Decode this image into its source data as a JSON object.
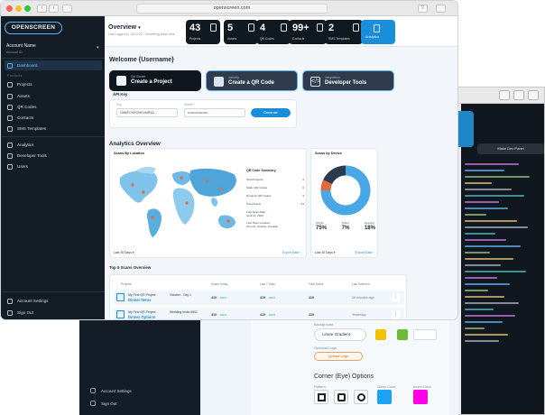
{
  "browser": {
    "url": "openscreen.com"
  },
  "brand": {
    "logo_text": "OPENSCREEN",
    "accent": "#1a8ed8",
    "sidebar_bg": "#141c25"
  },
  "account": {
    "name": "Account Name",
    "sub": "Account ID"
  },
  "sidebar": {
    "section_label": "Products",
    "items": [
      {
        "label": "Dashboard",
        "icon": "grid-icon"
      },
      {
        "label": "Projects",
        "icon": "folder-icon"
      },
      {
        "label": "Assets",
        "icon": "image-icon"
      },
      {
        "label": "QR Codes",
        "icon": "qr-icon"
      },
      {
        "label": "Contacts",
        "icon": "contacts-icon"
      },
      {
        "label": "SMS Templates",
        "icon": "sms-icon"
      },
      {
        "label": "Analytics",
        "icon": "chart-icon"
      },
      {
        "label": "Developer Tools",
        "icon": "code-icon"
      },
      {
        "label": "Users",
        "icon": "users-icon"
      }
    ],
    "bottom": [
      {
        "label": "Account Settings",
        "icon": "settings-icon"
      },
      {
        "label": "Sign Out",
        "icon": "signout-icon"
      }
    ]
  },
  "header": {
    "title": "Overview",
    "subtitle": "Last Logged In: 10/12/22 · Something about here",
    "stats": [
      {
        "value": "43",
        "label": "Projects"
      },
      {
        "value": "5",
        "label": "Assets"
      },
      {
        "value": "4",
        "label": "QR Codes"
      },
      {
        "value": "99+",
        "label": "Contacts"
      },
      {
        "value": "2",
        "label": "SMS Templates"
      }
    ],
    "analytics_label": "Analytics"
  },
  "welcome": "Welcome {Username}",
  "actions": [
    {
      "top": "Get Started",
      "label": "Create a Project"
    },
    {
      "top": "Instantly",
      "label": "Create a QR Code"
    },
    {
      "top": "Integrations",
      "label": "Developer Tools"
    }
  ],
  "api": {
    "title": "API Key",
    "key_label": "Key",
    "key_value": "G8MFCKRONFUMR3A...",
    "secret_label": "Secret**",
    "secret_value": "••••••••••••••••••",
    "generate": "Generate"
  },
  "analytics": {
    "title": "Analytics Overview",
    "location": {
      "title": "Scans By Location",
      "summary_title": "QR Code Summary",
      "rows": [
        {
          "label": "Total Projects",
          "value": "3"
        },
        {
          "label": "Static QR Codes",
          "value": "0"
        },
        {
          "label": "Dynamic QR Codes",
          "value": "3"
        },
        {
          "label": "Total Scans",
          "value": "24"
        }
      ],
      "last_scan_label": "Last Scan Date",
      "last_scan_value": "April 14, 2022",
      "last_loc_label": "Last Scan Location",
      "last_loc_value": "Toronto, Ontario, Canada",
      "range": "Last 30 Days",
      "export": "Export Data"
    },
    "device": {
      "title": "Scans by Device",
      "items": [
        {
          "label": "Mobile",
          "value": "75%"
        },
        {
          "label": "Tablet",
          "value": "7%"
        },
        {
          "label": "Desktop",
          "value": "18%"
        }
      ],
      "range": "Last 30 Days",
      "export": "Export Data"
    }
  },
  "chart_data": {
    "type": "pie",
    "title": "Scans by Device",
    "categories": [
      "Mobile",
      "Tablet",
      "Desktop"
    ],
    "values": [
      75,
      7,
      18
    ],
    "colors": [
      "#4aa7e6",
      "#e06a3b",
      "#2c3a4e"
    ]
  },
  "table": {
    "title": "Top 5 Scans Overview",
    "headers": [
      "Projects",
      "Scans Today",
      "Last 7 Days",
      "Total Scans",
      "Last Scanned"
    ],
    "rows": [
      {
        "project": "My First QR Project",
        "name": "Dinner Items",
        "group": "October - Day 1",
        "today": "410",
        "today_delta": "↑ 100%",
        "week": "419",
        "week_delta": "↑ 100%",
        "total": "419",
        "last": "26 minutes ago"
      },
      {
        "project": "My First QR Project",
        "name": "Dinner Options",
        "group": "Wedding Invite 6601",
        "today": "410",
        "today_delta": "↑ 100%",
        "week": "419",
        "week_delta": "↑ 100%",
        "total": "419",
        "last": "Yesterday"
      }
    ]
  },
  "editor": {
    "run_label": "Make Dev Panel"
  },
  "qr_options": {
    "background_label": "Background",
    "gradient": "Linear Gradient",
    "logo_label": "Optional Logo",
    "upload": "Upload Logo",
    "corner_title": "Corner (Eye) Options",
    "pattern_label": "Pattern",
    "outer_label": "Outer Color",
    "inner_label": "Inner Color"
  }
}
